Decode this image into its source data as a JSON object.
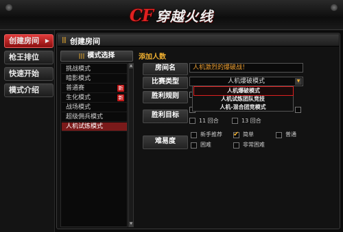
{
  "logo": {
    "mark": "CF",
    "title": "穿越火线"
  },
  "nav": {
    "items": [
      {
        "label": "创建房间",
        "active": true
      },
      {
        "label": "枪王排位",
        "active": false
      },
      {
        "label": "快速开始",
        "active": false
      },
      {
        "label": "模式介绍",
        "active": false
      }
    ],
    "arrow": "▶"
  },
  "panel": {
    "title": "创建房间"
  },
  "modes": {
    "header": "模式选择",
    "items": [
      {
        "label": "挑战模式",
        "badge": ""
      },
      {
        "label": "暗影模式",
        "badge": ""
      },
      {
        "label": "普通赛",
        "badge": "新"
      },
      {
        "label": "生化模式",
        "badge": "新"
      },
      {
        "label": "战场模式",
        "badge": ""
      },
      {
        "label": "超级佣兵模式",
        "badge": ""
      },
      {
        "label": "人机试炼模式",
        "badge": "",
        "selected": true
      }
    ]
  },
  "form": {
    "header": "添加人数",
    "room_name_label": "房间名",
    "room_name_value": "人机激烈的爆破战！",
    "match_type_label": "比赛类型",
    "match_type_value": "人机爆破模式",
    "win_rule_label": "胜利规则",
    "win_target_label": "胜利目标",
    "difficulty_label": "难易度",
    "dropdown_options": [
      {
        "label": "人机爆破模式",
        "selected": true
      },
      {
        "label": "人机试炼团队竞技",
        "selected": false
      },
      {
        "label": "人机-混合团竞模式",
        "selected": false
      }
    ],
    "rounds": [
      "11 回合",
      "13 回合"
    ],
    "difficulty": [
      {
        "label": "新手推荐",
        "checked": false
      },
      {
        "label": "简单",
        "checked": true
      },
      {
        "label": "普通",
        "checked": false
      },
      {
        "label": "困难",
        "checked": false
      },
      {
        "label": "非常困难",
        "checked": false
      }
    ],
    "check_mark": "✔"
  },
  "colors": {
    "accent_red": "#e02020",
    "accent_gold": "#f0b030"
  }
}
